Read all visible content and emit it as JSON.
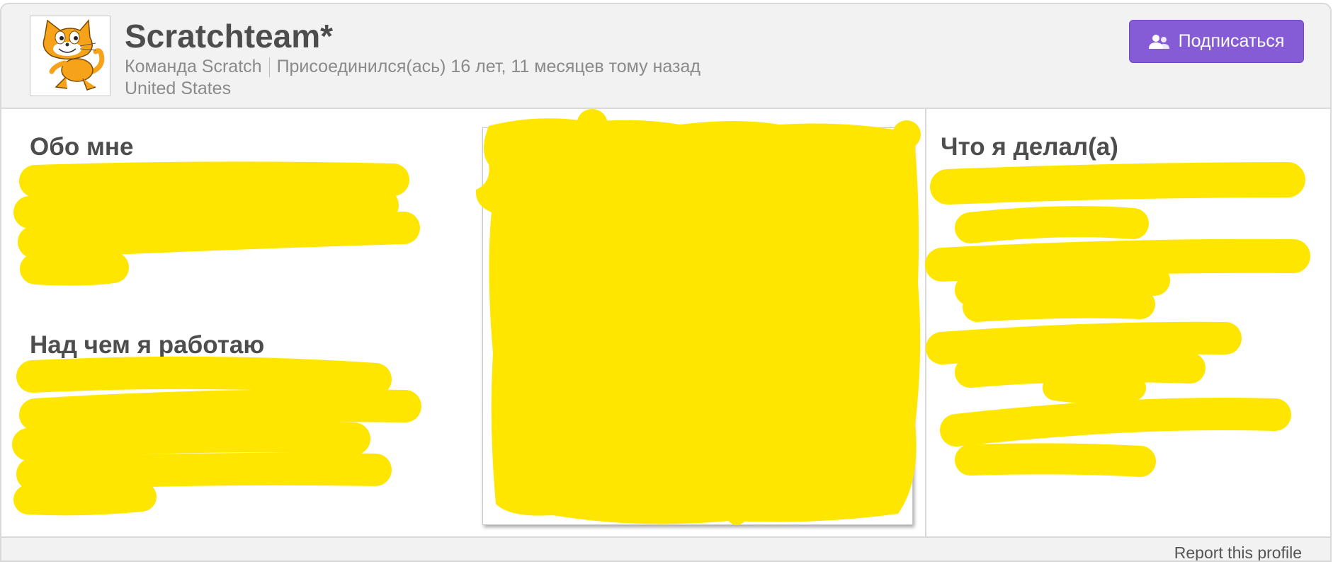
{
  "profile": {
    "username": "Scratchteam*",
    "role": "Команда Scratch",
    "joined": "Присоединился(ась) 16 лет, 11 месяцев тому назад",
    "location": "United States",
    "follow_label": "Подписаться"
  },
  "sections": {
    "about_me": "Обо мне",
    "working_on": "Над чем я работаю",
    "what_ive_been_doing": "Что я делал(а)"
  },
  "footer": {
    "report_label": "Report this profile"
  },
  "colors": {
    "accent": "#855cd6",
    "redaction": "#ffe600"
  },
  "icons": {
    "avatar": "scratch-cat-avatar",
    "follow": "users-icon"
  }
}
